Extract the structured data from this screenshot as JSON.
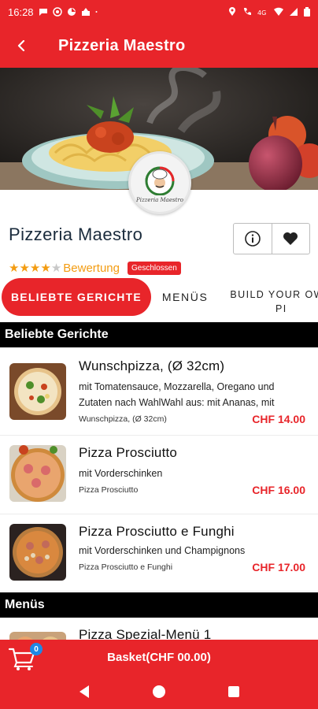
{
  "status_bar": {
    "time": "16:28",
    "icons_left": [
      "chat-icon",
      "whatsapp-icon",
      "app-icon",
      "tiktok-icon",
      "dot"
    ],
    "icons_right": [
      "location-icon",
      "call-icon",
      "volte-icon",
      "wifi-icon",
      "signal-icon",
      "battery-icon"
    ]
  },
  "app_bar": {
    "title": "Pizzeria Maestro",
    "back_icon": "arrow-back-icon"
  },
  "hero": {
    "logo_text": "Pizzeria Maestro"
  },
  "restaurant": {
    "name": "Pizzeria Maestro",
    "rating_stars": 4,
    "rating_max": 5,
    "rating_label": "Bewertung",
    "status": "Geschlossen",
    "info_icon": "info-icon",
    "favorite_icon": "heart-icon"
  },
  "tabs": [
    {
      "label": "BELIEBTE GERICHTE",
      "active": true
    },
    {
      "label": "MENÜS",
      "active": false
    },
    {
      "label": "BUILD YOUR OWN PI",
      "active": false
    }
  ],
  "tab3_lines": [
    "BUILD YOUR OWN",
    "PI"
  ],
  "sections": {
    "popular": {
      "title": "Beliebte Gerichte",
      "items": [
        {
          "title": "Wunschpizza, (Ø 32cm)",
          "description": "mit Tomatensauce, Mozzarella, Oregano und Zutaten nach WahlWahl aus: mit Ananas, mit",
          "subtitle": "Wunschpizza, (Ø 32cm)",
          "price": "CHF  14.00"
        },
        {
          "title": "Pizza Prosciutto",
          "description": "mit Vorderschinken",
          "subtitle": "Pizza Prosciutto",
          "price": "CHF  16.00"
        },
        {
          "title": "Pizza Prosciutto e Funghi",
          "description": "mit Vorderschinken und Champignons",
          "subtitle": "Pizza Prosciutto e Funghi",
          "price": "CHF  17.00"
        }
      ]
    },
    "menus": {
      "title": "Menüs",
      "items": [
        {
          "title": "Pizza Spezial-Menü 1"
        }
      ]
    }
  },
  "basket": {
    "label": "Basket(CHF 00.00)",
    "count": "0",
    "icon": "cart-icon"
  },
  "nav_bar": {
    "icons": [
      "back-triangle-icon",
      "home-circle-icon",
      "recents-square-icon"
    ]
  },
  "colors": {
    "primary": "#e8252a",
    "price": "#e8252a",
    "star": "#f39c12",
    "badge_count": "#1e88e5",
    "section_header": "#000000"
  }
}
